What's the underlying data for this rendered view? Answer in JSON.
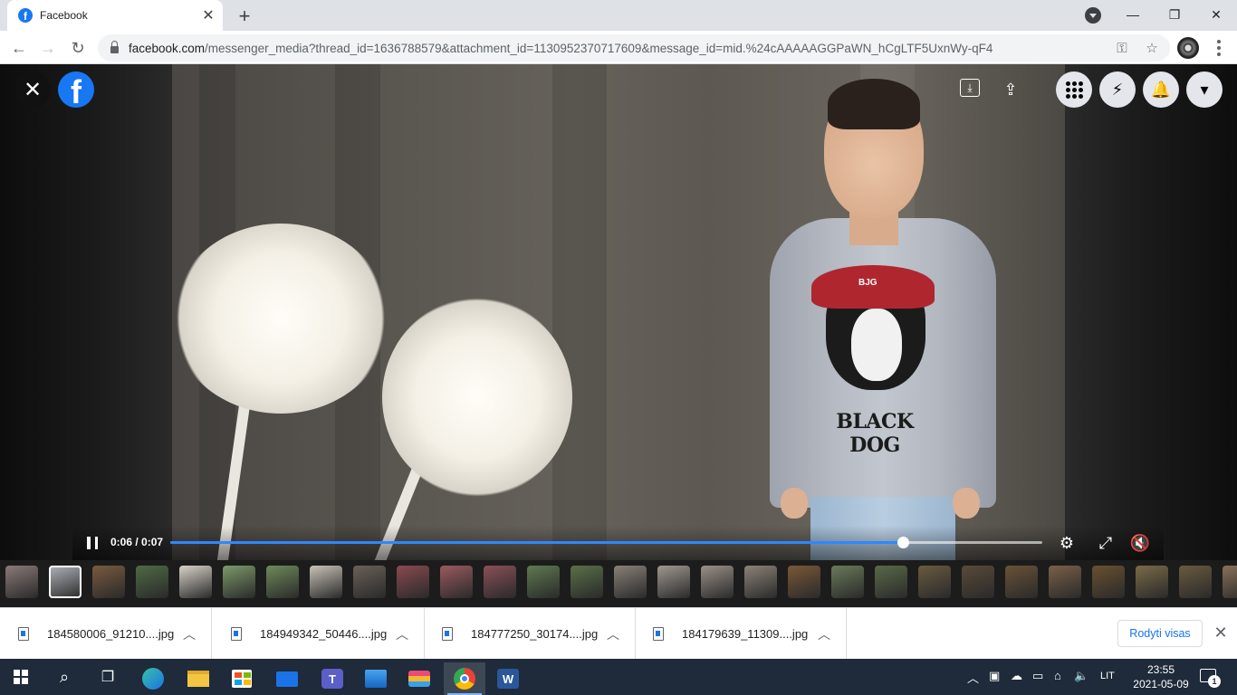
{
  "browser": {
    "tab_title": "Facebook",
    "tab_favicon": "f",
    "url_host": "facebook.com",
    "url_path": "/messenger_media?thread_id=1636788579&attachment_id=1130952370717609&message_id=mid.%24cAAAAAGGPaWN_hCgLTF5UxnWy-qF4"
  },
  "video_overlay": {
    "logo": "f",
    "shirt_text": "BLACK DOG",
    "cap_text": "BJG"
  },
  "player": {
    "time_display": "0:06 / 0:07",
    "progress_fraction": 0.84
  },
  "thumbnails": [
    {
      "color": "#8a7a78"
    },
    {
      "color": "#b0b4bb",
      "active": true
    },
    {
      "color": "#7a5a40"
    },
    {
      "color": "#4f6a45"
    },
    {
      "color": "#d8d2c8"
    },
    {
      "color": "#7c9a6a"
    },
    {
      "color": "#6e8a5a"
    },
    {
      "color": "#c9c2b8"
    },
    {
      "color": "#6a6058"
    },
    {
      "color": "#8a4a50"
    },
    {
      "color": "#9a5a60"
    },
    {
      "color": "#8a5058"
    },
    {
      "color": "#5e7a50"
    },
    {
      "color": "#5a7048"
    },
    {
      "color": "#8a8078"
    },
    {
      "color": "#a09890"
    },
    {
      "color": "#9a9088"
    },
    {
      "color": "#8c8278"
    },
    {
      "color": "#7a5838"
    },
    {
      "color": "#6a7a5a"
    },
    {
      "color": "#5a6a48"
    },
    {
      "color": "#6a5a40"
    },
    {
      "color": "#5a4a38"
    },
    {
      "color": "#6a5238"
    },
    {
      "color": "#7a6048"
    },
    {
      "color": "#6a5030"
    },
    {
      "color": "#7a6a48"
    },
    {
      "color": "#6a5a40"
    },
    {
      "color": "#8a7058"
    }
  ],
  "downloads": {
    "items": [
      {
        "name": "184580006_91210....jpg"
      },
      {
        "name": "184949342_50446....jpg"
      },
      {
        "name": "184777250_30174....jpg"
      },
      {
        "name": "184179639_11309....jpg"
      }
    ],
    "show_all": "Rodyti visas"
  },
  "taskbar": {
    "language": "LIT",
    "time": "23:55",
    "date": "2021-05-09",
    "notification_count": "1"
  }
}
